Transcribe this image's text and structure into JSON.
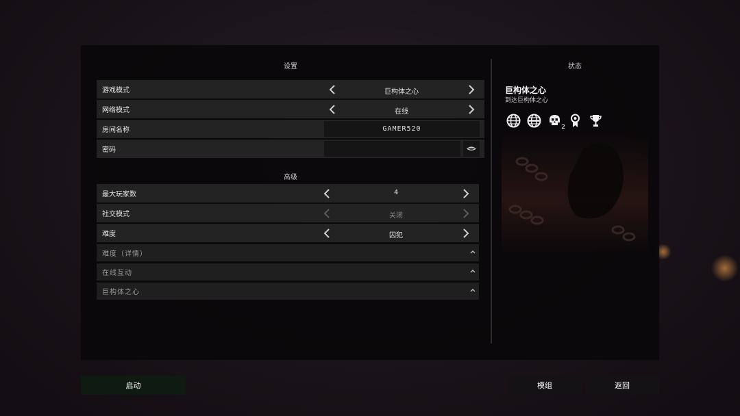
{
  "settings_title": "设置",
  "status_title": "状态",
  "advanced_title": "高级",
  "rows": {
    "game_mode": {
      "label": "游戏模式",
      "value": "巨构体之心"
    },
    "network_mode": {
      "label": "网络模式",
      "value": "在线"
    },
    "room_name": {
      "label": "房间名称",
      "value": "GAMER520"
    },
    "password": {
      "label": "密码",
      "value": ""
    }
  },
  "advanced": {
    "max_players": {
      "label": "最大玩家数",
      "value": "4"
    },
    "social_mode": {
      "label": "社交模式",
      "value": "关闭"
    },
    "difficulty": {
      "label": "难度",
      "value": "囚犯"
    }
  },
  "collapsibles": [
    "难度（详情）",
    "在线互动",
    "巨构体之心"
  ],
  "status": {
    "name": "巨构体之心",
    "desc": "到达巨构体之心",
    "icons": [
      "globe-icon",
      "globe-alt-icon",
      "skull-icon",
      "medal-icon",
      "trophy-icon"
    ],
    "skull_count": "2"
  },
  "buttons": {
    "start": "启动",
    "mods": "模组",
    "back": "返回"
  },
  "colors": {
    "accent_start": "#0f1a13",
    "row_bg": "#232323"
  }
}
